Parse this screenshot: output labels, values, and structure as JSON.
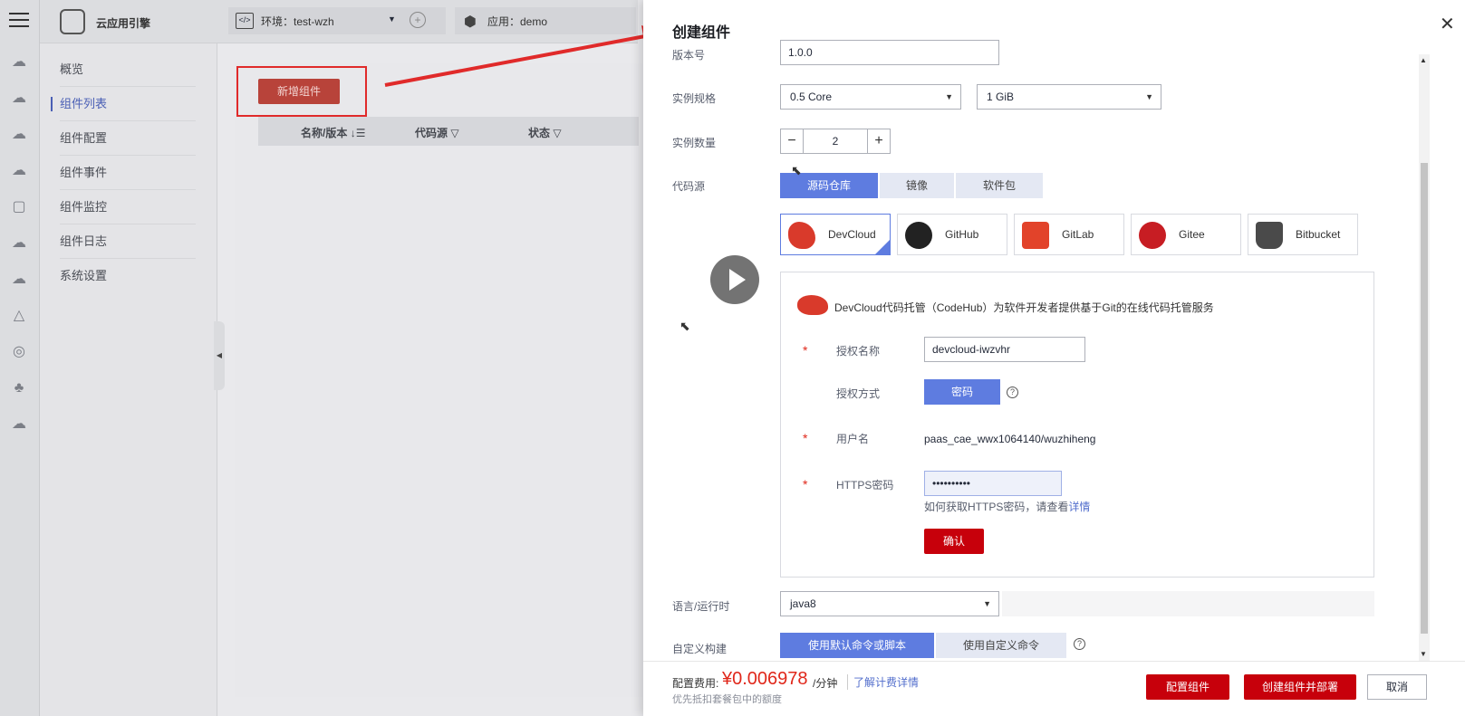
{
  "background_app": {
    "product_name": "云应用引擎",
    "environment_label": "环境：test-wzh",
    "application_label": "应用：demo",
    "nav_items": [
      "概览",
      "组件列表",
      "组件配置",
      "组件事件",
      "组件监控",
      "组件日志",
      "系统设置"
    ],
    "add_button_label": "新增组件",
    "table_headers": [
      "名称/版本",
      "代码源",
      "状态"
    ]
  },
  "drawer": {
    "title": "创建组件",
    "version_label": "版本号",
    "version_value": "1.0.0",
    "spec_label": "实例规格",
    "cpu_value": "0.5 Core",
    "memory_value": "1 GiB",
    "count_label": "实例数量",
    "count_value": "2",
    "source_label": "代码源",
    "source_tabs": [
      "源码仓库",
      "镜像",
      "软件包"
    ],
    "providers": [
      {
        "name": "DevCloud",
        "color": "#d93a2b"
      },
      {
        "name": "GitHub",
        "color": "#222222"
      },
      {
        "name": "GitLab",
        "color": "#e2432a"
      },
      {
        "name": "Gitee",
        "color": "#c71d23"
      },
      {
        "name": "Bitbucket",
        "color": "#4a4a4a"
      }
    ],
    "panel": {
      "description": "DevCloud代码托管（CodeHub）为软件开发者提供基于Git的在线代码托管服务",
      "auth_name_label": "授权名称",
      "auth_name_value": "devcloud-iwzvhr",
      "auth_method_label": "授权方式",
      "auth_method_value": "密码",
      "username_label": "用户名",
      "username_value": "paas_cae_wwx1064140/wuzhiheng",
      "https_pwd_label": "HTTPS密码",
      "https_pwd_value": "••••••••••",
      "help_text": "如何获取HTTPS密码，请查看",
      "help_link": "详情",
      "confirm_label": "确认"
    },
    "runtime_label": "语言/运行时",
    "runtime_value": "java8",
    "build_label": "自定义构建",
    "build_tabs": [
      "使用默认命令或脚本",
      "使用自定义命令"
    ],
    "footer": {
      "fee_label": "配置费用:",
      "fee_value": "¥0.006978",
      "fee_unit": "/分钟",
      "fee_link": "了解计费详情",
      "fee_note": "优先抵扣套餐包中的额度",
      "config_button": "配置组件",
      "create_deploy_button": "创建组件并部署",
      "cancel_button": "取消"
    }
  }
}
